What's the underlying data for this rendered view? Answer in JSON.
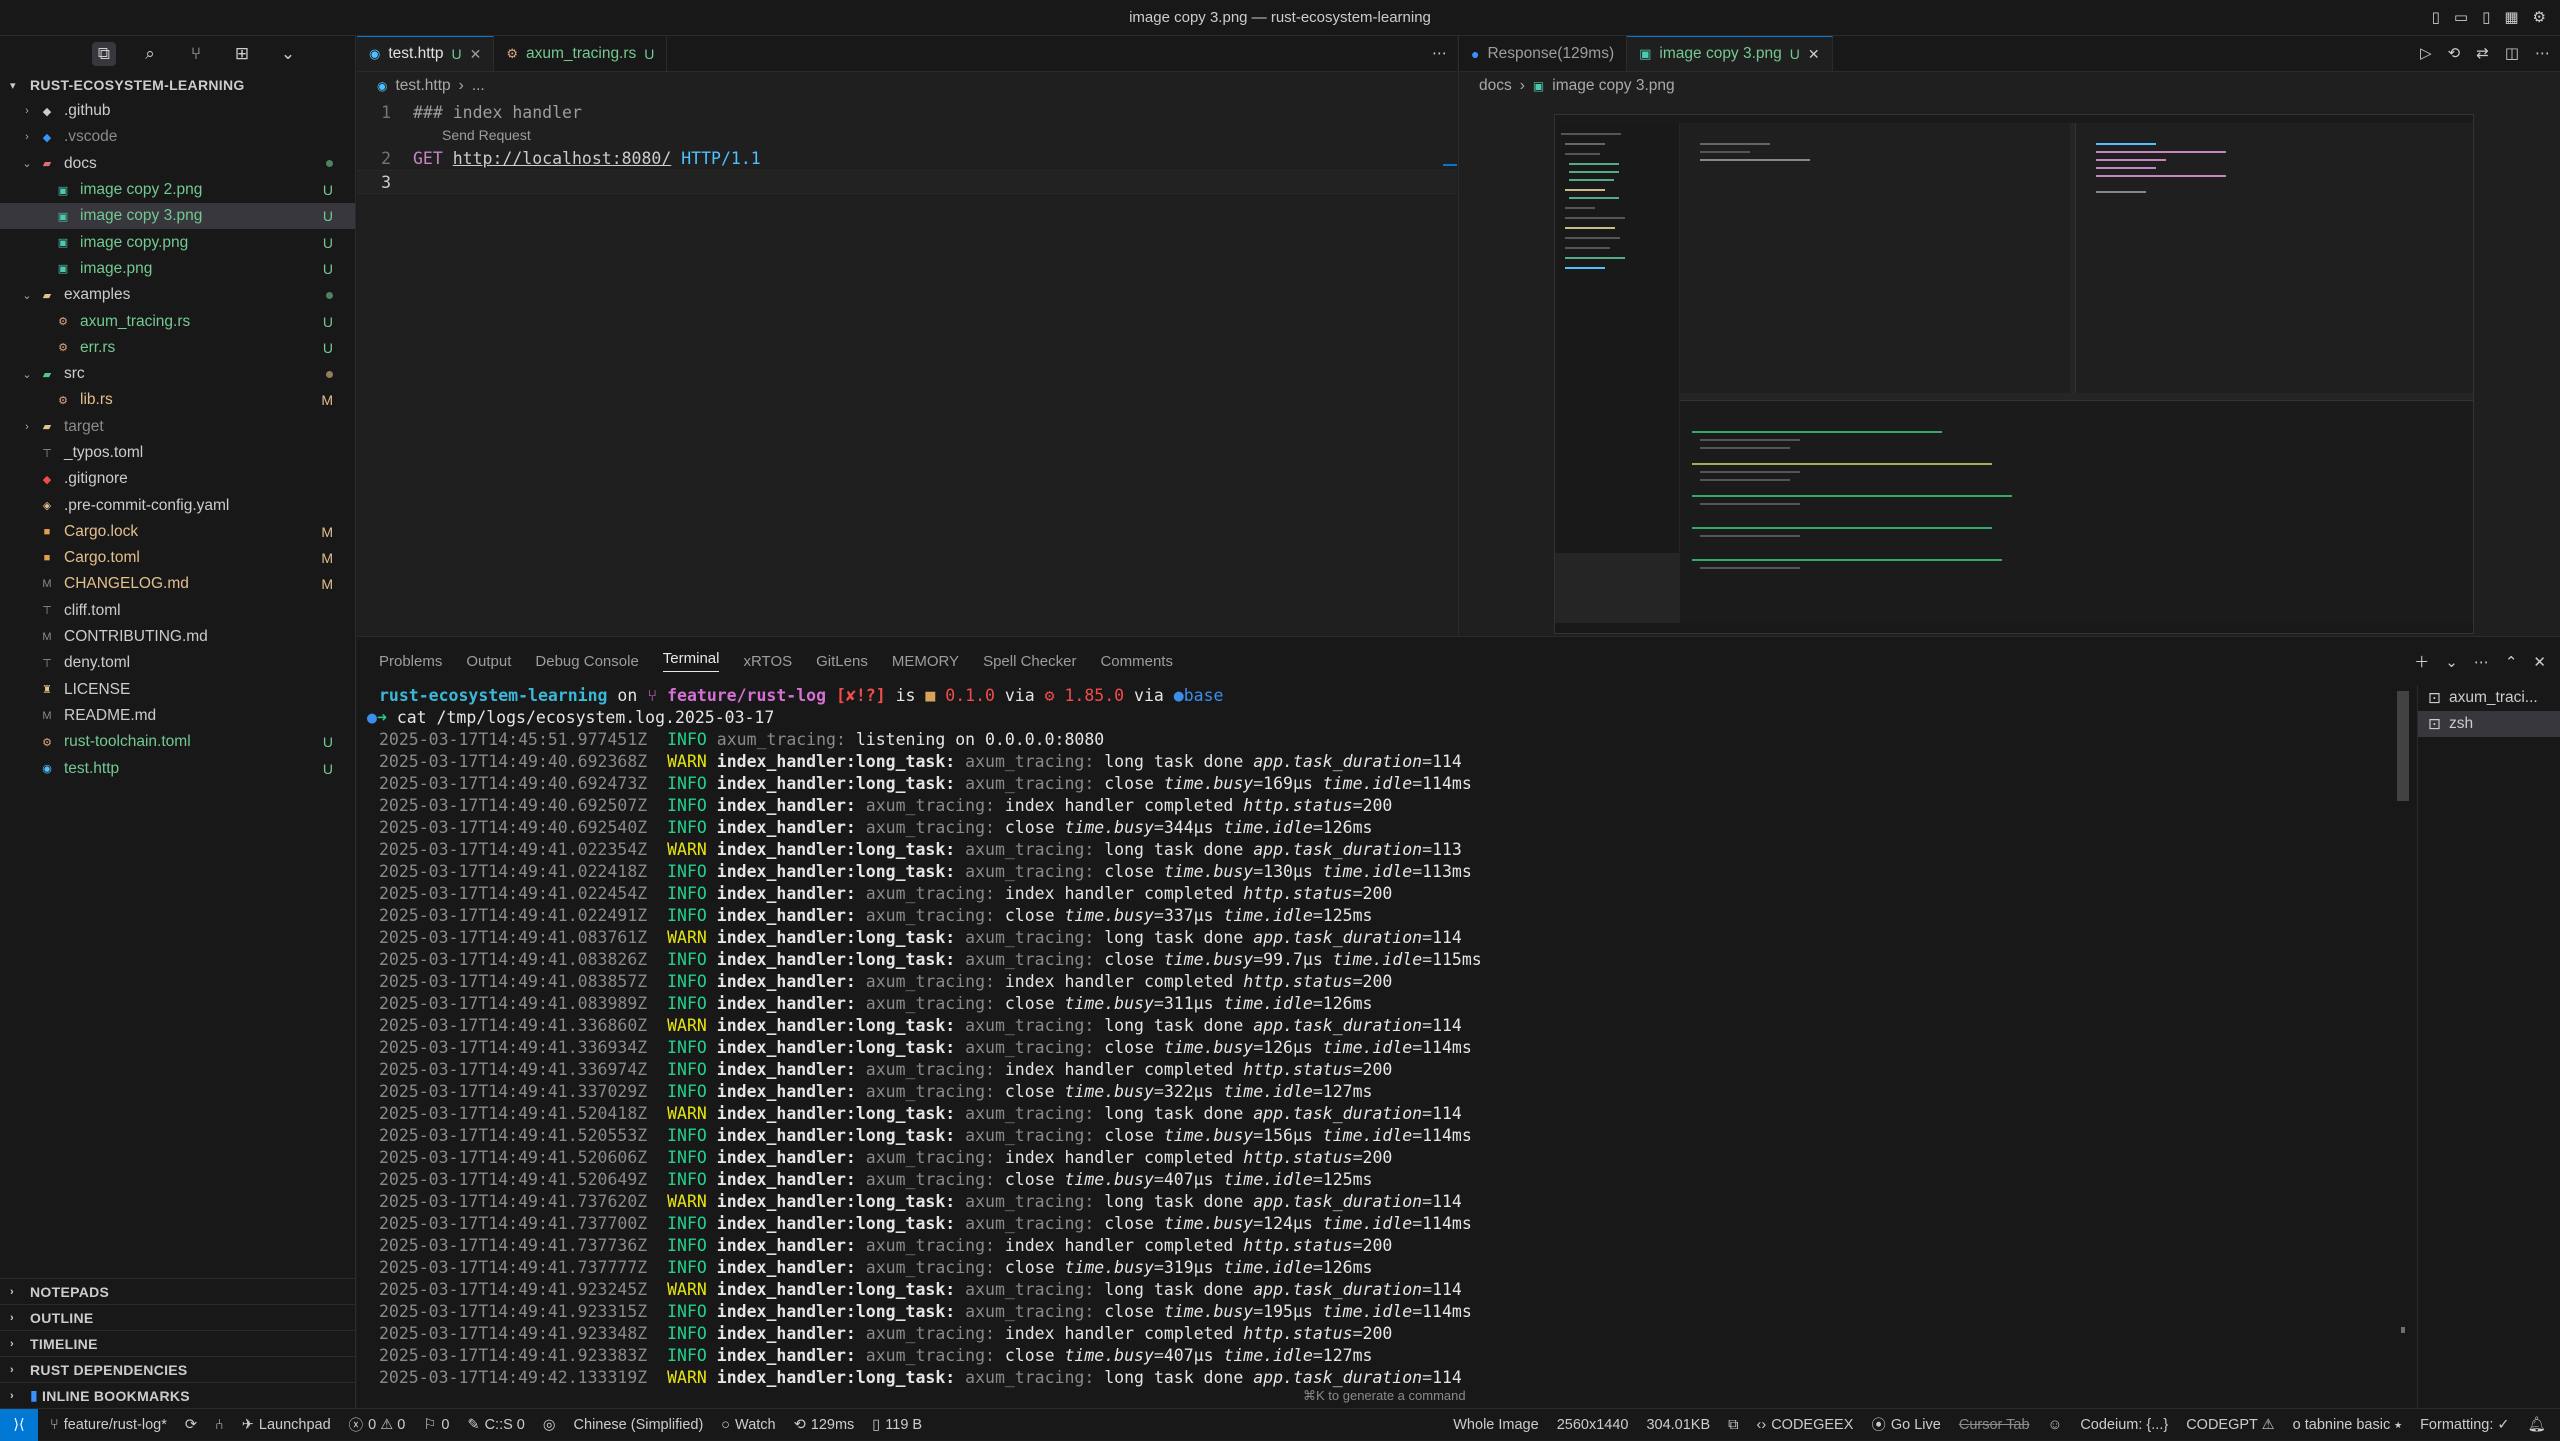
{
  "window": {
    "title": "image copy 3.png — rust-ecosystem-learning"
  },
  "explorer": {
    "root": "RUST-ECOSYSTEM-LEARNING",
    "items": [
      {
        "name": ".github",
        "kind": "folder",
        "expanded": false,
        "level": 1,
        "icon": "github-folder-icon"
      },
      {
        "name": ".vscode",
        "kind": "folder",
        "expanded": false,
        "level": 1,
        "icon": "vscode-folder-icon",
        "dim": true
      },
      {
        "name": "docs",
        "kind": "folder",
        "expanded": true,
        "level": 1,
        "icon": "docs-folder-icon",
        "dot": "#73c991"
      },
      {
        "name": "image copy 2.png",
        "kind": "file",
        "level": 2,
        "icon": "image-icon",
        "badge": "U",
        "color": "green"
      },
      {
        "name": "image copy 3.png",
        "kind": "file",
        "level": 2,
        "icon": "image-icon",
        "badge": "U",
        "color": "green",
        "selected": true
      },
      {
        "name": "image copy.png",
        "kind": "file",
        "level": 2,
        "icon": "image-icon",
        "badge": "U",
        "color": "green"
      },
      {
        "name": "image.png",
        "kind": "file",
        "level": 2,
        "icon": "image-icon",
        "badge": "U",
        "color": "green"
      },
      {
        "name": "examples",
        "kind": "folder",
        "expanded": true,
        "level": 1,
        "icon": "examples-folder-icon",
        "dot": "#73c991"
      },
      {
        "name": "axum_tracing.rs",
        "kind": "file",
        "level": 2,
        "icon": "rust-icon",
        "badge": "U",
        "color": "green"
      },
      {
        "name": "err.rs",
        "kind": "file",
        "level": 2,
        "icon": "rust-icon",
        "badge": "U",
        "color": "green"
      },
      {
        "name": "src",
        "kind": "folder",
        "expanded": true,
        "level": 1,
        "icon": "src-folder-icon",
        "dot": "#e2c08d"
      },
      {
        "name": "lib.rs",
        "kind": "file",
        "level": 2,
        "icon": "rust-icon",
        "badge": "M",
        "color": "yellow"
      },
      {
        "name": "target",
        "kind": "folder",
        "expanded": false,
        "level": 1,
        "icon": "target-folder-icon",
        "dim": true
      },
      {
        "name": "_typos.toml",
        "kind": "file",
        "level": 1,
        "icon": "toml-icon"
      },
      {
        "name": ".gitignore",
        "kind": "file",
        "level": 1,
        "icon": "git-icon"
      },
      {
        "name": ".pre-commit-config.yaml",
        "kind": "file",
        "level": 1,
        "icon": "yaml-icon"
      },
      {
        "name": "Cargo.lock",
        "kind": "file",
        "level": 1,
        "icon": "cargo-icon",
        "badge": "M",
        "color": "yellow"
      },
      {
        "name": "Cargo.toml",
        "kind": "file",
        "level": 1,
        "icon": "cargo-icon",
        "badge": "M",
        "color": "yellow"
      },
      {
        "name": "CHANGELOG.md",
        "kind": "file",
        "level": 1,
        "icon": "markdown-icon",
        "badge": "M",
        "color": "yellow"
      },
      {
        "name": "cliff.toml",
        "kind": "file",
        "level": 1,
        "icon": "toml-icon"
      },
      {
        "name": "CONTRIBUTING.md",
        "kind": "file",
        "level": 1,
        "icon": "markdown-icon"
      },
      {
        "name": "deny.toml",
        "kind": "file",
        "level": 1,
        "icon": "toml-icon"
      },
      {
        "name": "LICENSE",
        "kind": "file",
        "level": 1,
        "icon": "license-icon"
      },
      {
        "name": "README.md",
        "kind": "file",
        "level": 1,
        "icon": "markdown-icon"
      },
      {
        "name": "rust-toolchain.toml",
        "kind": "file",
        "level": 1,
        "icon": "rust-icon",
        "badge": "U",
        "color": "green"
      },
      {
        "name": "test.http",
        "kind": "file",
        "level": 1,
        "icon": "http-icon",
        "badge": "U",
        "color": "green"
      }
    ],
    "bottom_sections": [
      "NOTEPADS",
      "OUTLINE",
      "TIMELINE",
      "RUST DEPENDENCIES",
      "INLINE BOOKMARKS"
    ]
  },
  "editor1": {
    "tabs": [
      {
        "label": "test.http",
        "status": "U",
        "active": true
      },
      {
        "label": "axum_tracing.rs",
        "status": "U",
        "active": false
      }
    ],
    "breadcrumb": [
      "test.http",
      "..."
    ],
    "lines": [
      {
        "num": "1",
        "text": "### index handler"
      },
      {
        "num": "2",
        "method": "GET",
        "url": "http://localhost:8080/",
        "version": "HTTP/1.1"
      },
      {
        "num": "3",
        "text": ""
      }
    ],
    "codelens": "Send Request"
  },
  "editor2": {
    "tabs": [
      {
        "label": "Response(129ms)",
        "active": false
      },
      {
        "label": "image copy 3.png",
        "status": "U",
        "active": true
      }
    ],
    "breadcrumb": [
      "docs",
      "image copy 3.png"
    ]
  },
  "panel": {
    "tabs": [
      "Problems",
      "Output",
      "Debug Console",
      "Terminal",
      "xRTOS",
      "GitLens",
      "MEMORY",
      "Spell Checker",
      "Comments"
    ],
    "active_tab": "Terminal",
    "terminals": [
      {
        "label": "axum_traci...",
        "selected": false
      },
      {
        "label": "zsh",
        "selected": true
      }
    ],
    "prompt": {
      "dir": "rust-ecosystem-learning",
      "on": "on",
      "branch": "feature/rust-log",
      "git_status": "[✘!?]",
      "is": "is",
      "pkg_version": "0.1.0",
      "via1": "via",
      "rust_version": "1.85.0",
      "via2": "via",
      "env": "base"
    },
    "command": "cat /tmp/logs/ecosystem.log.2025-03-17",
    "log_lines": [
      {
        "ts": "2025-03-17T14:45:51.977451Z",
        "level": "INFO",
        "span": "",
        "target": "axum_tracing:",
        "msg": "listening on 0.0.0.0:8080",
        "kv": []
      },
      {
        "ts": "2025-03-17T14:49:40.692368Z",
        "level": "WARN",
        "span": "index_handler:long_task:",
        "target": "axum_tracing:",
        "msg": "long task done",
        "kv": [
          [
            "app.task_duration",
            "114"
          ]
        ]
      },
      {
        "ts": "2025-03-17T14:49:40.692473Z",
        "level": "INFO",
        "span": "index_handler:long_task:",
        "target": "axum_tracing:",
        "msg": "close",
        "kv": [
          [
            "time.busy",
            "169µs"
          ],
          [
            "time.idle",
            "114ms"
          ]
        ]
      },
      {
        "ts": "2025-03-17T14:49:40.692507Z",
        "level": "INFO",
        "span": "index_handler:",
        "target": "axum_tracing:",
        "msg": "index handler completed",
        "kv": [
          [
            "http.status",
            "200"
          ]
        ]
      },
      {
        "ts": "2025-03-17T14:49:40.692540Z",
        "level": "INFO",
        "span": "index_handler:",
        "target": "axum_tracing:",
        "msg": "close",
        "kv": [
          [
            "time.busy",
            "344µs"
          ],
          [
            "time.idle",
            "126ms"
          ]
        ]
      },
      {
        "ts": "2025-03-17T14:49:41.022354Z",
        "level": "WARN",
        "span": "index_handler:long_task:",
        "target": "axum_tracing:",
        "msg": "long task done",
        "kv": [
          [
            "app.task_duration",
            "113"
          ]
        ]
      },
      {
        "ts": "2025-03-17T14:49:41.022418Z",
        "level": "INFO",
        "span": "index_handler:long_task:",
        "target": "axum_tracing:",
        "msg": "close",
        "kv": [
          [
            "time.busy",
            "130µs"
          ],
          [
            "time.idle",
            "113ms"
          ]
        ]
      },
      {
        "ts": "2025-03-17T14:49:41.022454Z",
        "level": "INFO",
        "span": "index_handler:",
        "target": "axum_tracing:",
        "msg": "index handler completed",
        "kv": [
          [
            "http.status",
            "200"
          ]
        ]
      },
      {
        "ts": "2025-03-17T14:49:41.022491Z",
        "level": "INFO",
        "span": "index_handler:",
        "target": "axum_tracing:",
        "msg": "close",
        "kv": [
          [
            "time.busy",
            "337µs"
          ],
          [
            "time.idle",
            "125ms"
          ]
        ]
      },
      {
        "ts": "2025-03-17T14:49:41.083761Z",
        "level": "WARN",
        "span": "index_handler:long_task:",
        "target": "axum_tracing:",
        "msg": "long task done",
        "kv": [
          [
            "app.task_duration",
            "114"
          ]
        ]
      },
      {
        "ts": "2025-03-17T14:49:41.083826Z",
        "level": "INFO",
        "span": "index_handler:long_task:",
        "target": "axum_tracing:",
        "msg": "close",
        "kv": [
          [
            "time.busy",
            "99.7µs"
          ],
          [
            "time.idle",
            "115ms"
          ]
        ]
      },
      {
        "ts": "2025-03-17T14:49:41.083857Z",
        "level": "INFO",
        "span": "index_handler:",
        "target": "axum_tracing:",
        "msg": "index handler completed",
        "kv": [
          [
            "http.status",
            "200"
          ]
        ]
      },
      {
        "ts": "2025-03-17T14:49:41.083989Z",
        "level": "INFO",
        "span": "index_handler:",
        "target": "axum_tracing:",
        "msg": "close",
        "kv": [
          [
            "time.busy",
            "311µs"
          ],
          [
            "time.idle",
            "126ms"
          ]
        ]
      },
      {
        "ts": "2025-03-17T14:49:41.336860Z",
        "level": "WARN",
        "span": "index_handler:long_task:",
        "target": "axum_tracing:",
        "msg": "long task done",
        "kv": [
          [
            "app.task_duration",
            "114"
          ]
        ]
      },
      {
        "ts": "2025-03-17T14:49:41.336934Z",
        "level": "INFO",
        "span": "index_handler:long_task:",
        "target": "axum_tracing:",
        "msg": "close",
        "kv": [
          [
            "time.busy",
            "126µs"
          ],
          [
            "time.idle",
            "114ms"
          ]
        ]
      },
      {
        "ts": "2025-03-17T14:49:41.336974Z",
        "level": "INFO",
        "span": "index_handler:",
        "target": "axum_tracing:",
        "msg": "index handler completed",
        "kv": [
          [
            "http.status",
            "200"
          ]
        ]
      },
      {
        "ts": "2025-03-17T14:49:41.337029Z",
        "level": "INFO",
        "span": "index_handler:",
        "target": "axum_tracing:",
        "msg": "close",
        "kv": [
          [
            "time.busy",
            "322µs"
          ],
          [
            "time.idle",
            "127ms"
          ]
        ]
      },
      {
        "ts": "2025-03-17T14:49:41.520418Z",
        "level": "WARN",
        "span": "index_handler:long_task:",
        "target": "axum_tracing:",
        "msg": "long task done",
        "kv": [
          [
            "app.task_duration",
            "114"
          ]
        ]
      },
      {
        "ts": "2025-03-17T14:49:41.520553Z",
        "level": "INFO",
        "span": "index_handler:long_task:",
        "target": "axum_tracing:",
        "msg": "close",
        "kv": [
          [
            "time.busy",
            "156µs"
          ],
          [
            "time.idle",
            "114ms"
          ]
        ]
      },
      {
        "ts": "2025-03-17T14:49:41.520606Z",
        "level": "INFO",
        "span": "index_handler:",
        "target": "axum_tracing:",
        "msg": "index handler completed",
        "kv": [
          [
            "http.status",
            "200"
          ]
        ]
      },
      {
        "ts": "2025-03-17T14:49:41.520649Z",
        "level": "INFO",
        "span": "index_handler:",
        "target": "axum_tracing:",
        "msg": "close",
        "kv": [
          [
            "time.busy",
            "407µs"
          ],
          [
            "time.idle",
            "125ms"
          ]
        ]
      },
      {
        "ts": "2025-03-17T14:49:41.737620Z",
        "level": "WARN",
        "span": "index_handler:long_task:",
        "target": "axum_tracing:",
        "msg": "long task done",
        "kv": [
          [
            "app.task_duration",
            "114"
          ]
        ]
      },
      {
        "ts": "2025-03-17T14:49:41.737700Z",
        "level": "INFO",
        "span": "index_handler:long_task:",
        "target": "axum_tracing:",
        "msg": "close",
        "kv": [
          [
            "time.busy",
            "124µs"
          ],
          [
            "time.idle",
            "114ms"
          ]
        ]
      },
      {
        "ts": "2025-03-17T14:49:41.737736Z",
        "level": "INFO",
        "span": "index_handler:",
        "target": "axum_tracing:",
        "msg": "index handler completed",
        "kv": [
          [
            "http.status",
            "200"
          ]
        ]
      },
      {
        "ts": "2025-03-17T14:49:41.737777Z",
        "level": "INFO",
        "span": "index_handler:",
        "target": "axum_tracing:",
        "msg": "close",
        "kv": [
          [
            "time.busy",
            "319µs"
          ],
          [
            "time.idle",
            "126ms"
          ]
        ]
      },
      {
        "ts": "2025-03-17T14:49:41.923245Z",
        "level": "WARN",
        "span": "index_handler:long_task:",
        "target": "axum_tracing:",
        "msg": "long task done",
        "kv": [
          [
            "app.task_duration",
            "114"
          ]
        ]
      },
      {
        "ts": "2025-03-17T14:49:41.923315Z",
        "level": "INFO",
        "span": "index_handler:long_task:",
        "target": "axum_tracing:",
        "msg": "close",
        "kv": [
          [
            "time.busy",
            "195µs"
          ],
          [
            "time.idle",
            "114ms"
          ]
        ]
      },
      {
        "ts": "2025-03-17T14:49:41.923348Z",
        "level": "INFO",
        "span": "index_handler:",
        "target": "axum_tracing:",
        "msg": "index handler completed",
        "kv": [
          [
            "http.status",
            "200"
          ]
        ]
      },
      {
        "ts": "2025-03-17T14:49:41.923383Z",
        "level": "INFO",
        "span": "index_handler:",
        "target": "axum_tracing:",
        "msg": "close",
        "kv": [
          [
            "time.busy",
            "407µs"
          ],
          [
            "time.idle",
            "127ms"
          ]
        ]
      },
      {
        "ts": "2025-03-17T14:49:42.133319Z",
        "level": "WARN",
        "span": "index_handler:long_task:",
        "target": "axum_tracing:",
        "msg": "long task done",
        "kv": [
          [
            "app.task_duration",
            "114"
          ]
        ]
      }
    ],
    "cmdk_hint": "⌘K to generate a command"
  },
  "statusbar": {
    "left": [
      {
        "label": "feature/rust-log*",
        "icon": "branch-icon"
      },
      {
        "label": "",
        "icon": "sync-icon"
      },
      {
        "label": "",
        "icon": "git-graph-icon"
      },
      {
        "label": "Launchpad",
        "icon": "launchpad-icon"
      },
      {
        "label": "0 ⚠ 0",
        "icon": "error-icon"
      },
      {
        "label": "0",
        "icon": "ports-icon"
      },
      {
        "label": "C::S 0",
        "icon": "edit-icon"
      },
      {
        "label": "",
        "icon": "broadcast-icon"
      },
      {
        "label": "Chinese (Simplified)",
        "icon": ""
      },
      {
        "label": "Watch",
        "icon": "watch-icon"
      },
      {
        "label": "129ms",
        "icon": "history-icon"
      },
      {
        "label": "119 B",
        "icon": "file-size-icon"
      }
    ],
    "right": [
      {
        "label": "Whole Image",
        "strike": false
      },
      {
        "label": "2560x1440",
        "strike": false
      },
      {
        "label": "304.01KB",
        "strike": false
      },
      {
        "label": "",
        "icon": "extension-icon"
      },
      {
        "label": "CODEGEEX",
        "icon": "codegeex-icon"
      },
      {
        "label": "Go Live",
        "icon": "golive-icon"
      },
      {
        "label": "Cursor Tab",
        "strike": true
      },
      {
        "label": "",
        "icon": "account-icon"
      },
      {
        "label": "Codeium: {...}",
        "strike": false
      },
      {
        "label": "CODEGPT ⚠",
        "strike": false
      },
      {
        "label": "o tabnine basic ⭑",
        "strike": false
      },
      {
        "label": "Formatting: ✓",
        "strike": false
      },
      {
        "label": "",
        "icon": "bell-icon"
      }
    ]
  }
}
